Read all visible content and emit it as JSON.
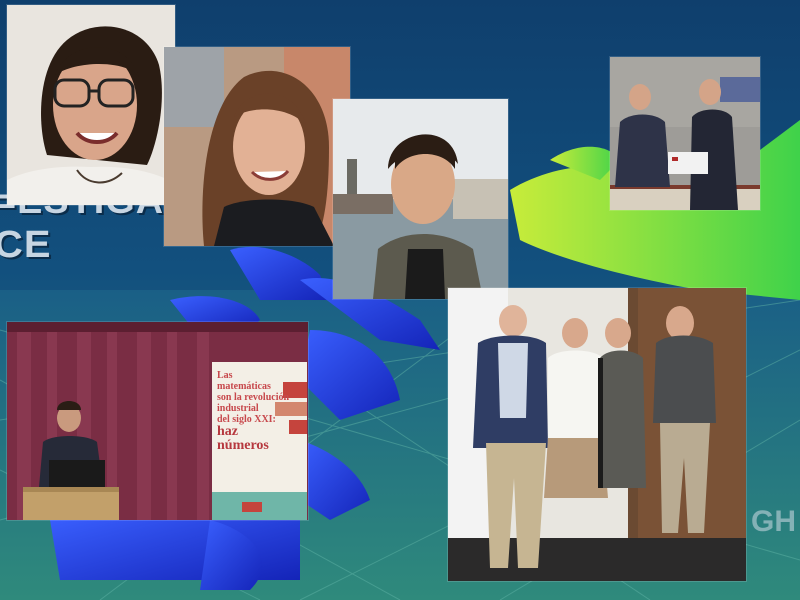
{
  "background": {
    "text_line1": "=ESTIGAC",
    "text_line2": "CE",
    "text_right": "GH",
    "colors": {
      "sky": "#12507e",
      "mesh_green": "#2e8a79",
      "robot_hand_blue": "#1b3fd6",
      "human_hand_green": "#7ee03a"
    }
  },
  "sign": {
    "line1": "Las",
    "line2": "matemáticas",
    "line3": "son la revolución",
    "line4": "industrial",
    "line5": "del siglo XXI:",
    "line6": "haz",
    "line7": "números"
  },
  "photos": [
    {
      "name": "portrait-woman-glasses"
    },
    {
      "name": "portrait-woman-long-hair"
    },
    {
      "name": "portrait-man-london"
    },
    {
      "name": "award-ceremony"
    },
    {
      "name": "lecture-speaker"
    },
    {
      "name": "group-of-four"
    }
  ]
}
